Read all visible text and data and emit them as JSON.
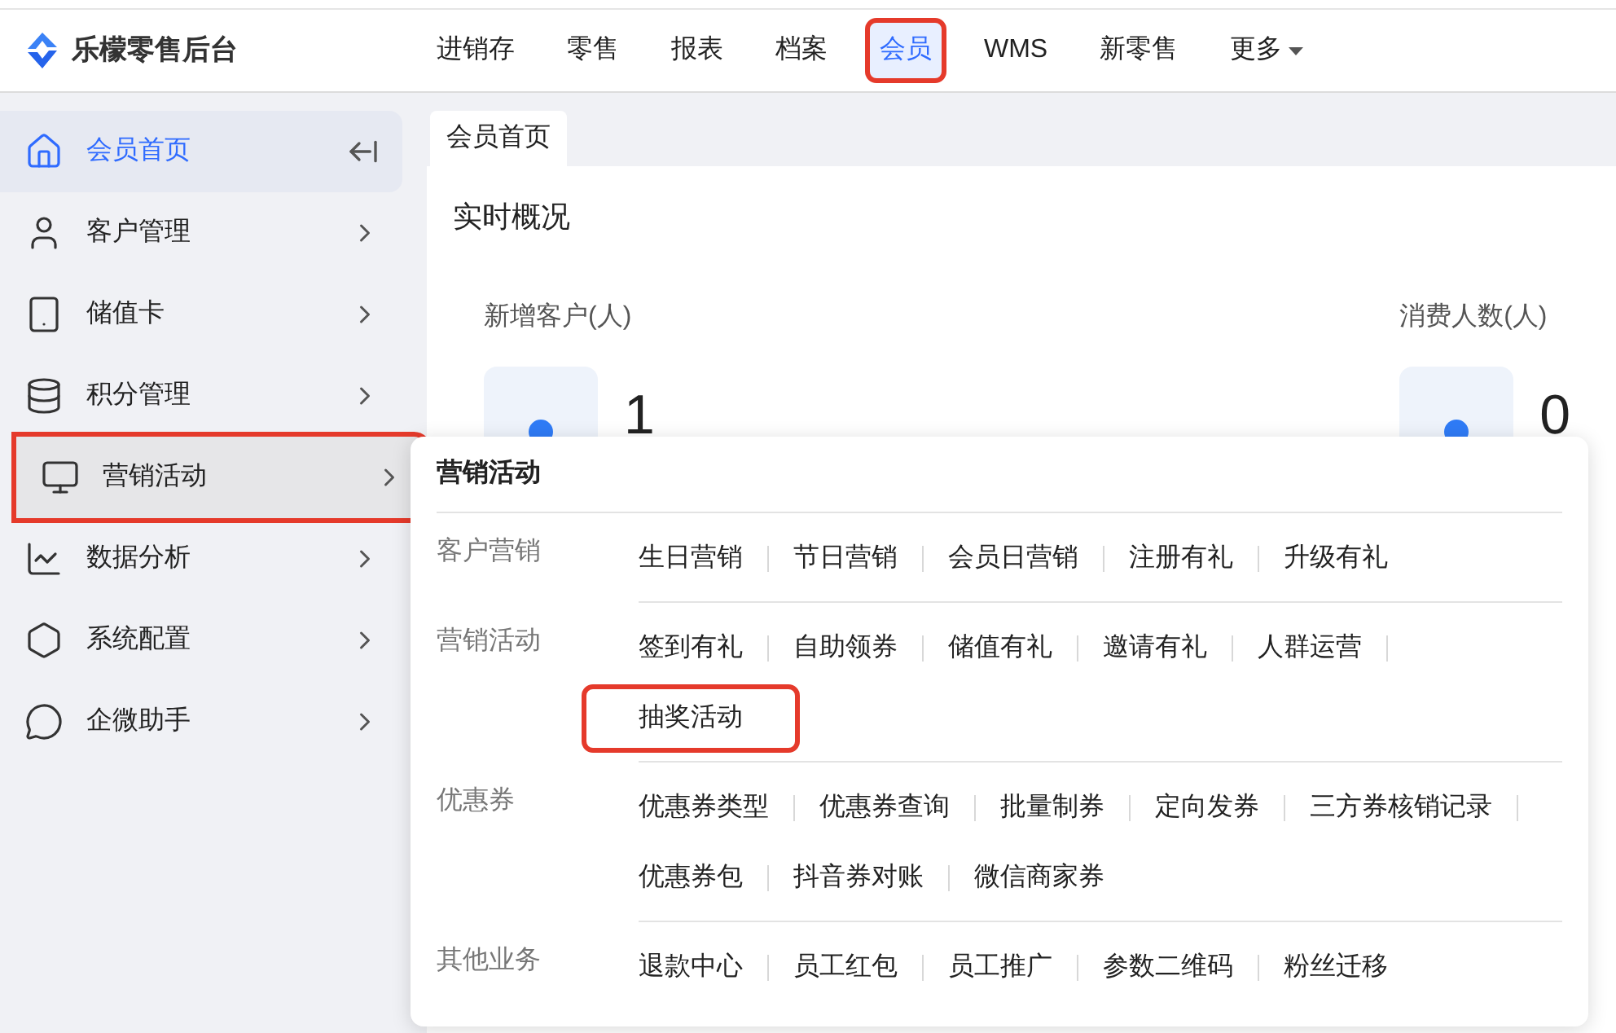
{
  "brand": {
    "name": "乐檬零售后台"
  },
  "nav": [
    {
      "label": "进销存",
      "selected": false,
      "highlighted": false
    },
    {
      "label": "零售",
      "selected": false,
      "highlighted": false
    },
    {
      "label": "报表",
      "selected": false,
      "highlighted": false
    },
    {
      "label": "档案",
      "selected": false,
      "highlighted": false
    },
    {
      "label": "会员",
      "selected": true,
      "highlighted": true
    },
    {
      "label": "WMS",
      "selected": false,
      "highlighted": false
    },
    {
      "label": "新零售",
      "selected": false,
      "highlighted": false
    },
    {
      "label": "更多",
      "selected": false,
      "highlighted": false,
      "dropdown": true
    }
  ],
  "sidebar": {
    "items": [
      {
        "label": "会员首页",
        "selected": true,
        "hovered": false,
        "highlighted": false
      },
      {
        "label": "客户管理",
        "selected": false,
        "hovered": false,
        "highlighted": false
      },
      {
        "label": "储值卡",
        "selected": false,
        "hovered": false,
        "highlighted": false
      },
      {
        "label": "积分管理",
        "selected": false,
        "hovered": false,
        "highlighted": false
      },
      {
        "label": "营销活动",
        "selected": false,
        "hovered": true,
        "highlighted": true
      },
      {
        "label": "数据分析",
        "selected": false,
        "hovered": false,
        "highlighted": false
      },
      {
        "label": "系统配置",
        "selected": false,
        "hovered": false,
        "highlighted": false
      },
      {
        "label": "企微助手",
        "selected": false,
        "hovered": false,
        "highlighted": false
      }
    ]
  },
  "page_tab": {
    "label": "会员首页"
  },
  "overview": {
    "title": "实时概况",
    "stats": [
      {
        "label": "新增客户(人)",
        "value": "1"
      },
      {
        "label": "消费人数(人)",
        "value": "0"
      }
    ]
  },
  "flyout": {
    "title": "营销活动",
    "groups": [
      {
        "label": "客户营销",
        "rows": [
          [
            {
              "label": "生日营销",
              "highlighted": false
            },
            {
              "label": "节日营销",
              "highlighted": false
            },
            {
              "label": "会员日营销",
              "highlighted": false
            },
            {
              "label": "注册有礼",
              "highlighted": false
            },
            {
              "label": "升级有礼",
              "highlighted": false
            }
          ]
        ]
      },
      {
        "label": "营销活动",
        "rows": [
          [
            {
              "label": "签到有礼",
              "highlighted": false
            },
            {
              "label": "自助领券",
              "highlighted": false
            },
            {
              "label": "储值有礼",
              "highlighted": false
            },
            {
              "label": "邀请有礼",
              "highlighted": false
            },
            {
              "label": "人群运营",
              "highlighted": false
            }
          ],
          [
            {
              "label": "抽奖活动",
              "highlighted": true
            }
          ]
        ]
      },
      {
        "label": "优惠券",
        "rows": [
          [
            {
              "label": "优惠券类型",
              "highlighted": false
            },
            {
              "label": "优惠券查询",
              "highlighted": false
            },
            {
              "label": "批量制券",
              "highlighted": false
            },
            {
              "label": "定向发券",
              "highlighted": false
            },
            {
              "label": "三方券核销记录",
              "highlighted": false
            }
          ],
          [
            {
              "label": "优惠券包",
              "highlighted": false
            },
            {
              "label": "抖音券对账",
              "highlighted": false
            },
            {
              "label": "微信商家券",
              "highlighted": false
            }
          ]
        ]
      },
      {
        "label": "其他业务",
        "rows": [
          [
            {
              "label": "退款中心",
              "highlighted": false
            },
            {
              "label": "员工红包",
              "highlighted": false
            },
            {
              "label": "员工推广",
              "highlighted": false
            },
            {
              "label": "参数二维码",
              "highlighted": false
            },
            {
              "label": "粉丝迁移",
              "highlighted": false
            }
          ]
        ]
      }
    ]
  }
}
